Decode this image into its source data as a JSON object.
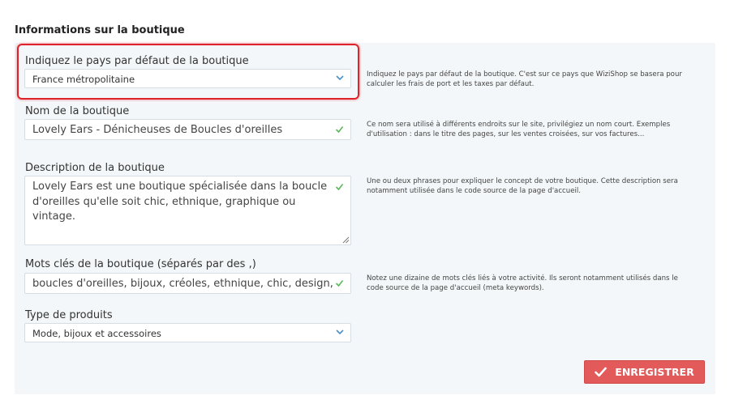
{
  "section": {
    "title": "Informations sur la boutique"
  },
  "fields": {
    "country": {
      "label": "Indiquez le pays par défaut de la boutique",
      "value": "France métropolitaine",
      "help": "Indiquez le pays par défaut de la boutique. C'est sur ce pays que WiziShop se basera pour calculer les frais de port et les taxes par défaut."
    },
    "name": {
      "label": "Nom de la boutique",
      "value": "Lovely Ears - Dénicheuses de Boucles d'oreilles",
      "help": "Ce nom sera utilisé à différents endroits sur le site, privilégiez un nom court. Exemples d'utilisation : dans le titre des pages, sur les ventes croisées, sur vos factures..."
    },
    "description": {
      "label": "Description de la boutique",
      "value": "Lovely Ears est une boutique spécialisée dans la boucle d'oreilles qu'elle soit chic, ethnique, graphique ou vintage.",
      "help": "Une ou deux phrases pour expliquer le concept de votre boutique. Cette description sera notamment utilisée dans le code source de la page d'accueil."
    },
    "keywords": {
      "label": "Mots clés de la boutique (séparés par des ,)",
      "value": "boucles d'oreilles, bijoux, créoles, ethnique, chic, design, vintage",
      "help": "Notez une dizaine de mots clés liés à votre activité. Ils seront notamment utilisés dans le code source de la page d'accueil (meta keywords)."
    },
    "product_type": {
      "label": "Type de produits",
      "value": "Mode, bijoux et accessoires"
    }
  },
  "actions": {
    "save_label": "ENREGISTRER"
  },
  "icons": {
    "select": "chevron-down-icon",
    "valid": "check-icon",
    "save": "check-icon"
  },
  "colors": {
    "accent": "#e35a5a",
    "valid": "#5cb85c",
    "highlight": "#e0232a",
    "chevron": "#4a90c8"
  }
}
